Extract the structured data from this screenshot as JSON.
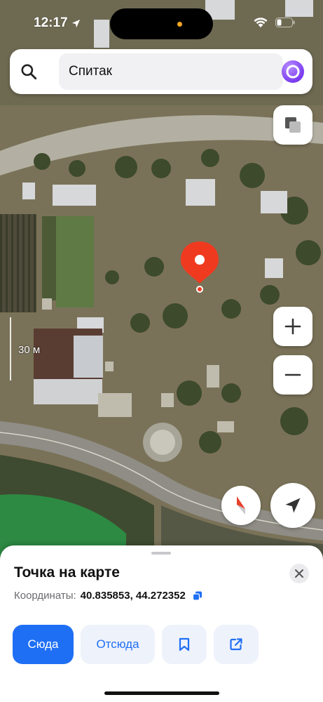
{
  "status_bar": {
    "time": "12:17"
  },
  "search": {
    "query": "Спитак"
  },
  "map": {
    "scale_label": "30 м"
  },
  "sheet": {
    "title": "Точка на карте",
    "coords_label": "Координаты:",
    "coords_value": "40.835853, 44.272352",
    "btn_to": "Сюда",
    "btn_from": "Отсюда"
  },
  "colors": {
    "accent": "#1f6ff5",
    "pin": "#f03a1f",
    "alice": "#7a3cf0"
  },
  "icons": [
    "search-icon",
    "alice-icon",
    "layers-icon",
    "plus-icon",
    "minus-icon",
    "compass-icon",
    "location-arrow-icon",
    "close-icon",
    "copy-icon",
    "bookmark-icon",
    "share-icon",
    "map-pin-icon"
  ]
}
